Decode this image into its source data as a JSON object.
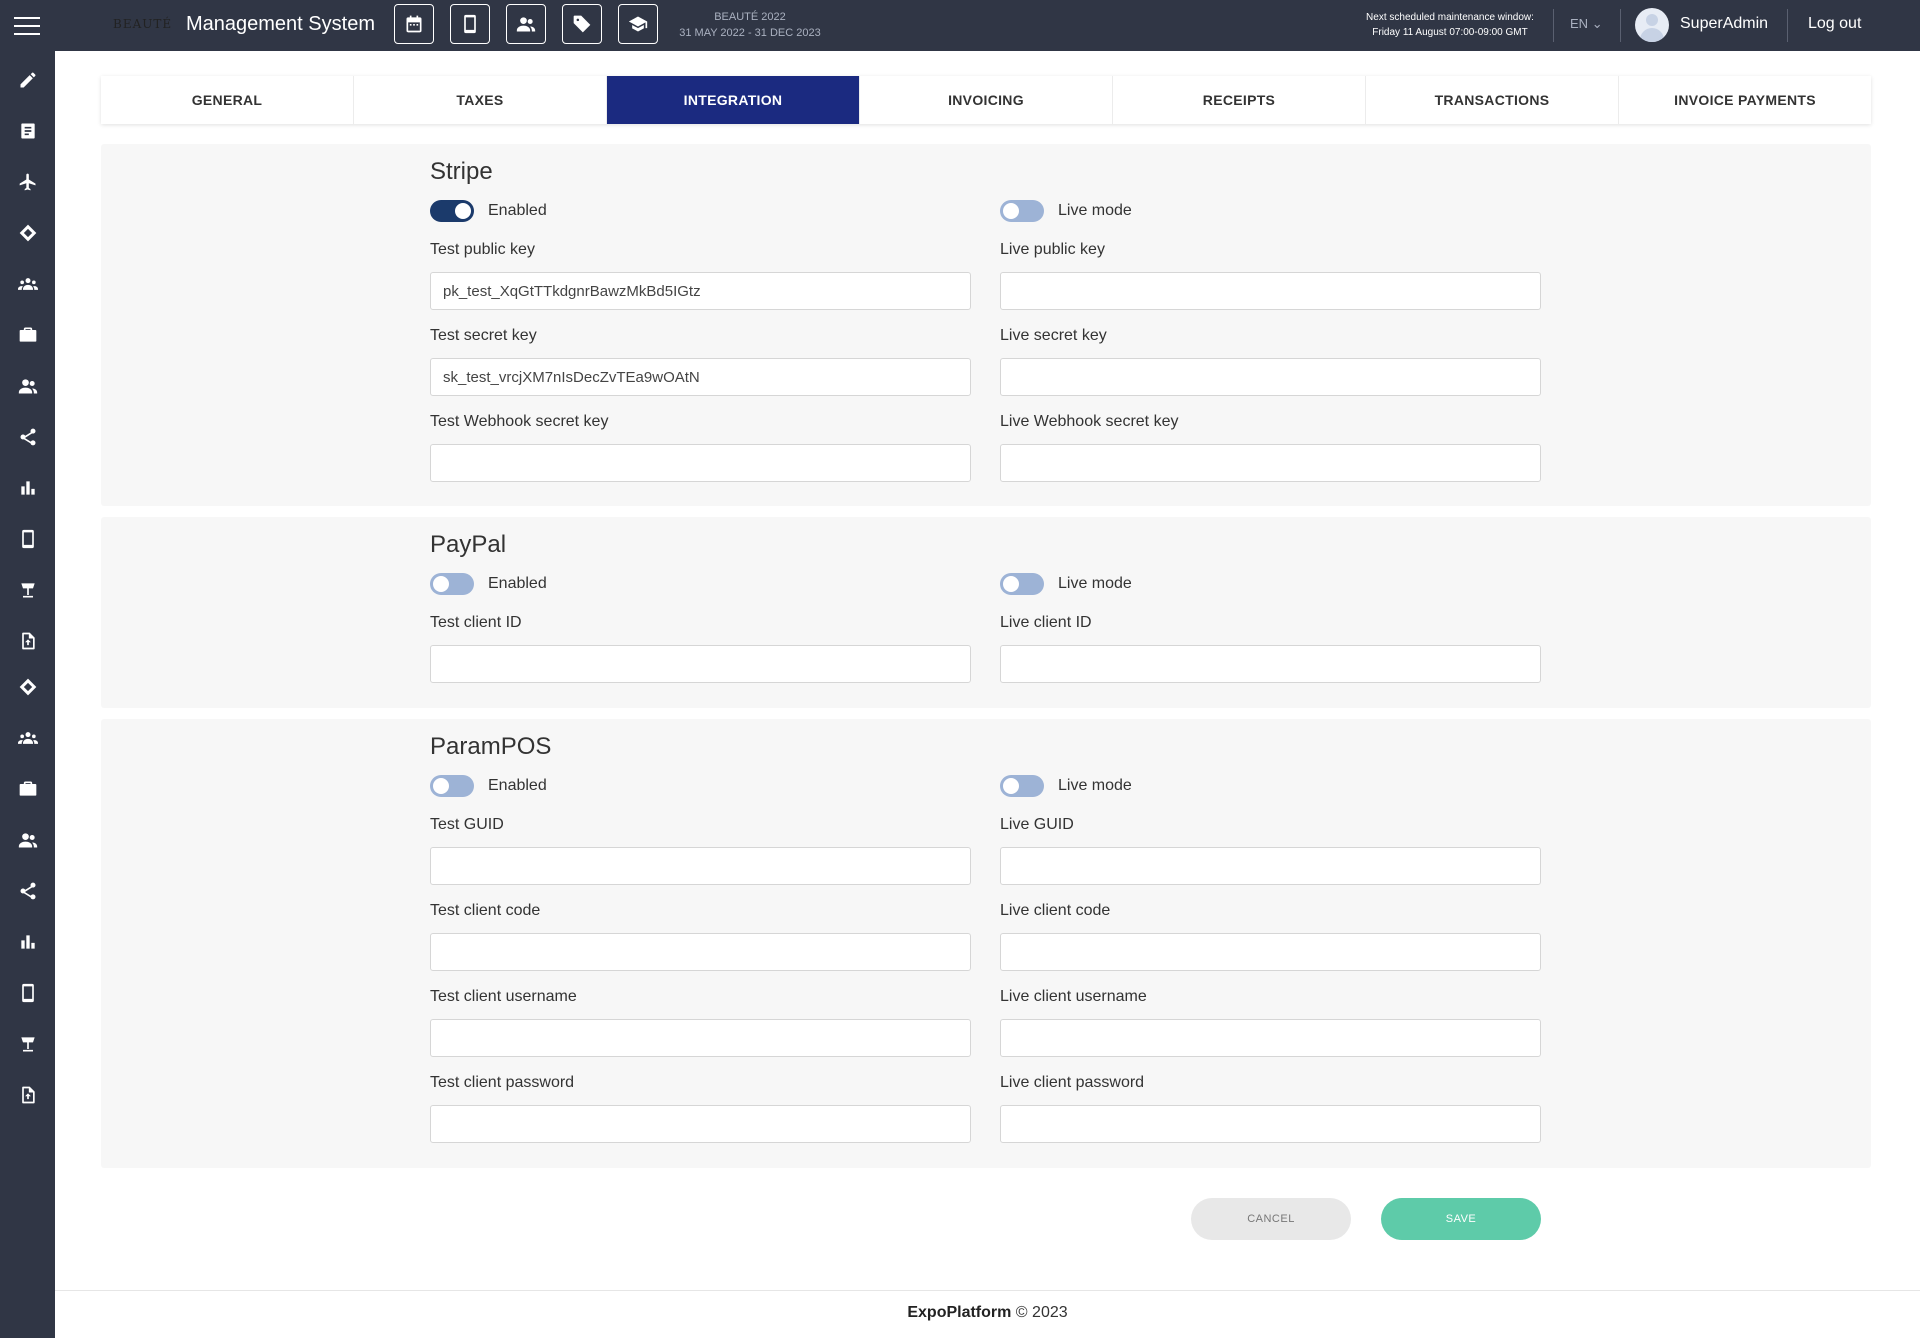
{
  "header": {
    "brand": "BEAUTÉ",
    "app_title": "Management System",
    "event_name": "BEAUTÉ 2022",
    "event_dates": "31 MAY 2022 - 31 DEC 2023",
    "maintenance_title": "Next scheduled maintenance window:",
    "maintenance_time": "Friday 11 August 07:00-09:00 GMT",
    "language": "EN",
    "user_name": "SuperAdmin",
    "logout_label": "Log out",
    "shortcut_icons": [
      "calendar-icon",
      "mobile-icon",
      "people-icon",
      "tag-icon",
      "graduation-cap-icon"
    ]
  },
  "sidebar": {
    "icons": [
      "pencil-icon",
      "document-icon",
      "plane-icon",
      "ticket-icon",
      "group-icon",
      "briefcase-icon",
      "users-icon",
      "share-icon",
      "bar-chart-icon",
      "mobile-icon",
      "lamp-icon",
      "file-upload-icon",
      "ticket-icon",
      "group-icon",
      "briefcase-icon",
      "users-icon",
      "share-icon",
      "bar-chart-icon",
      "mobile-icon",
      "lamp-icon",
      "file-upload-icon"
    ]
  },
  "tabs": [
    {
      "label": "GENERAL",
      "active": false
    },
    {
      "label": "TAXES",
      "active": false
    },
    {
      "label": "INTEGRATION",
      "active": true
    },
    {
      "label": "INVOICING",
      "active": false
    },
    {
      "label": "RECEIPTS",
      "active": false
    },
    {
      "label": "TRANSACTIONS",
      "active": false
    },
    {
      "label": "INVOICE PAYMENTS",
      "active": false
    }
  ],
  "stripe": {
    "title": "Stripe",
    "enabled_label": "Enabled",
    "enabled": true,
    "live_mode_label": "Live mode",
    "live_mode": false,
    "test_public_key_label": "Test public key",
    "test_public_key": "pk_test_XqGtTTkdgnrBawzMkBd5IGtz",
    "live_public_key_label": "Live public key",
    "live_public_key": "",
    "test_secret_key_label": "Test secret key",
    "test_secret_key": "sk_test_vrcjXM7nIsDecZvTEa9wOAtN",
    "live_secret_key_label": "Live secret key",
    "live_secret_key": "",
    "test_webhook_label": "Test Webhook secret key",
    "test_webhook": "",
    "live_webhook_label": "Live Webhook secret key",
    "live_webhook": ""
  },
  "paypal": {
    "title": "PayPal",
    "enabled_label": "Enabled",
    "enabled": false,
    "live_mode_label": "Live mode",
    "live_mode": false,
    "test_client_id_label": "Test client ID",
    "test_client_id": "",
    "live_client_id_label": "Live client ID",
    "live_client_id": ""
  },
  "parampos": {
    "title": "ParamPOS",
    "enabled_label": "Enabled",
    "enabled": false,
    "live_mode_label": "Live mode",
    "live_mode": false,
    "test_guid_label": "Test GUID",
    "live_guid_label": "Live GUID",
    "test_client_code_label": "Test client code",
    "live_client_code_label": "Live client code",
    "test_client_username_label": "Test client username",
    "live_client_username_label": "Live client username",
    "test_client_password_label": "Test client password",
    "live_client_password_label": "Live client password"
  },
  "actions": {
    "cancel_label": "CANCEL",
    "save_label": "SAVE"
  },
  "footer": {
    "brand": "ExpoPlatform",
    "copyright": " © 2023"
  }
}
